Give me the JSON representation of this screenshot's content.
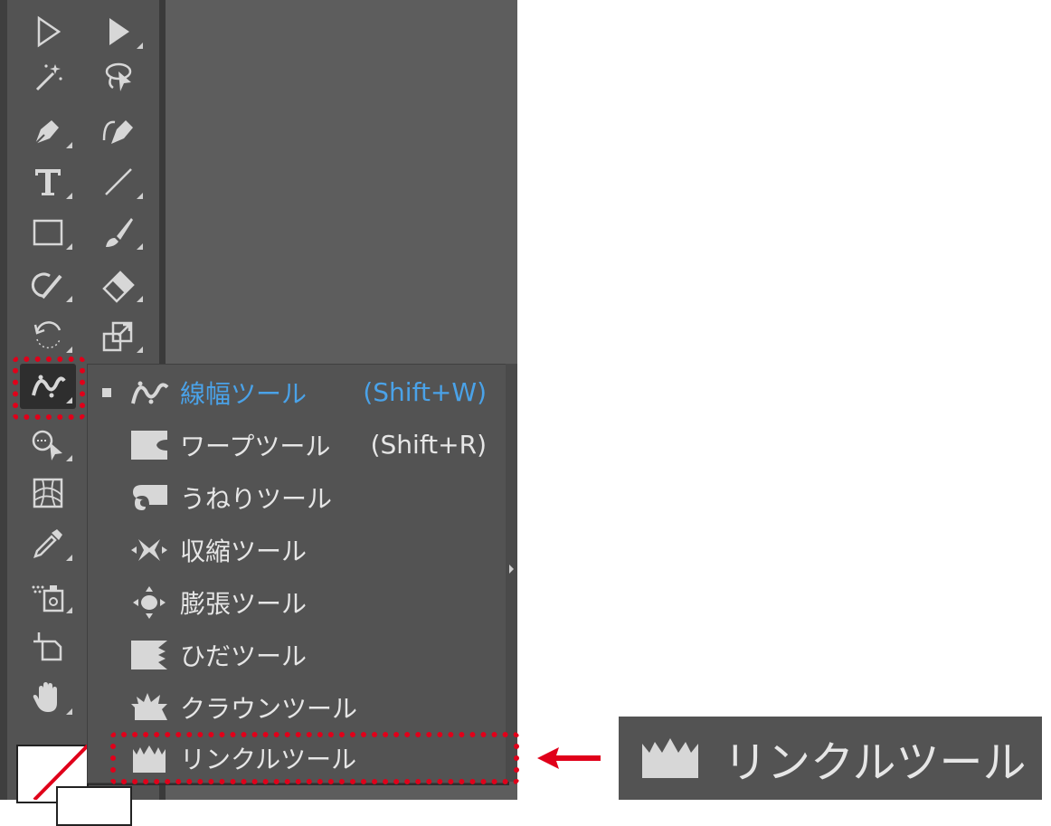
{
  "flyout": {
    "items": [
      {
        "label": "線幅ツール",
        "shortcut": "(Shift+W)",
        "icon": "width-tool-icon",
        "selected": true
      },
      {
        "label": "ワープツール",
        "shortcut": "(Shift+R)",
        "icon": "warp-tool-icon",
        "selected": false
      },
      {
        "label": "うねりツール",
        "shortcut": "",
        "icon": "twirl-tool-icon",
        "selected": false
      },
      {
        "label": "収縮ツール",
        "shortcut": "",
        "icon": "pucker-tool-icon",
        "selected": false
      },
      {
        "label": "膨張ツール",
        "shortcut": "",
        "icon": "bloat-tool-icon",
        "selected": false
      },
      {
        "label": "ひだツール",
        "shortcut": "",
        "icon": "scallop-tool-icon",
        "selected": false
      },
      {
        "label": "クラウンツール",
        "shortcut": "",
        "icon": "crystallize-tool-icon",
        "selected": false
      },
      {
        "label": "リンクルツール",
        "shortcut": "",
        "icon": "wrinkle-tool-icon",
        "selected": false
      }
    ]
  },
  "callout": {
    "label": "リンクルツール",
    "icon": "wrinkle-tool-icon"
  },
  "colors": {
    "highlight": "#e0001a",
    "selected_text": "#4aa2e8",
    "panel_bg": "#535353",
    "icon_fill": "#d7d7d7"
  },
  "toolbar": {
    "tools": [
      "selection-tool-icon",
      "direct-selection-tool-icon",
      "magic-wand-tool-icon",
      "lasso-tool-icon",
      "pen-tool-icon",
      "curvature-tool-icon",
      "type-tool-icon",
      "line-segment-tool-icon",
      "rectangle-tool-icon",
      "paintbrush-tool-icon",
      "shaper-tool-icon",
      "eraser-tool-icon",
      "rotate-tool-icon",
      "scale-tool-icon",
      "width-tool-icon",
      "shape-builder-tool-icon",
      "perspective-grid-tool-icon",
      "eyedropper-tool-icon",
      "symbol-sprayer-tool-icon",
      "artboard-tool-icon",
      "hand-tool-icon"
    ]
  }
}
